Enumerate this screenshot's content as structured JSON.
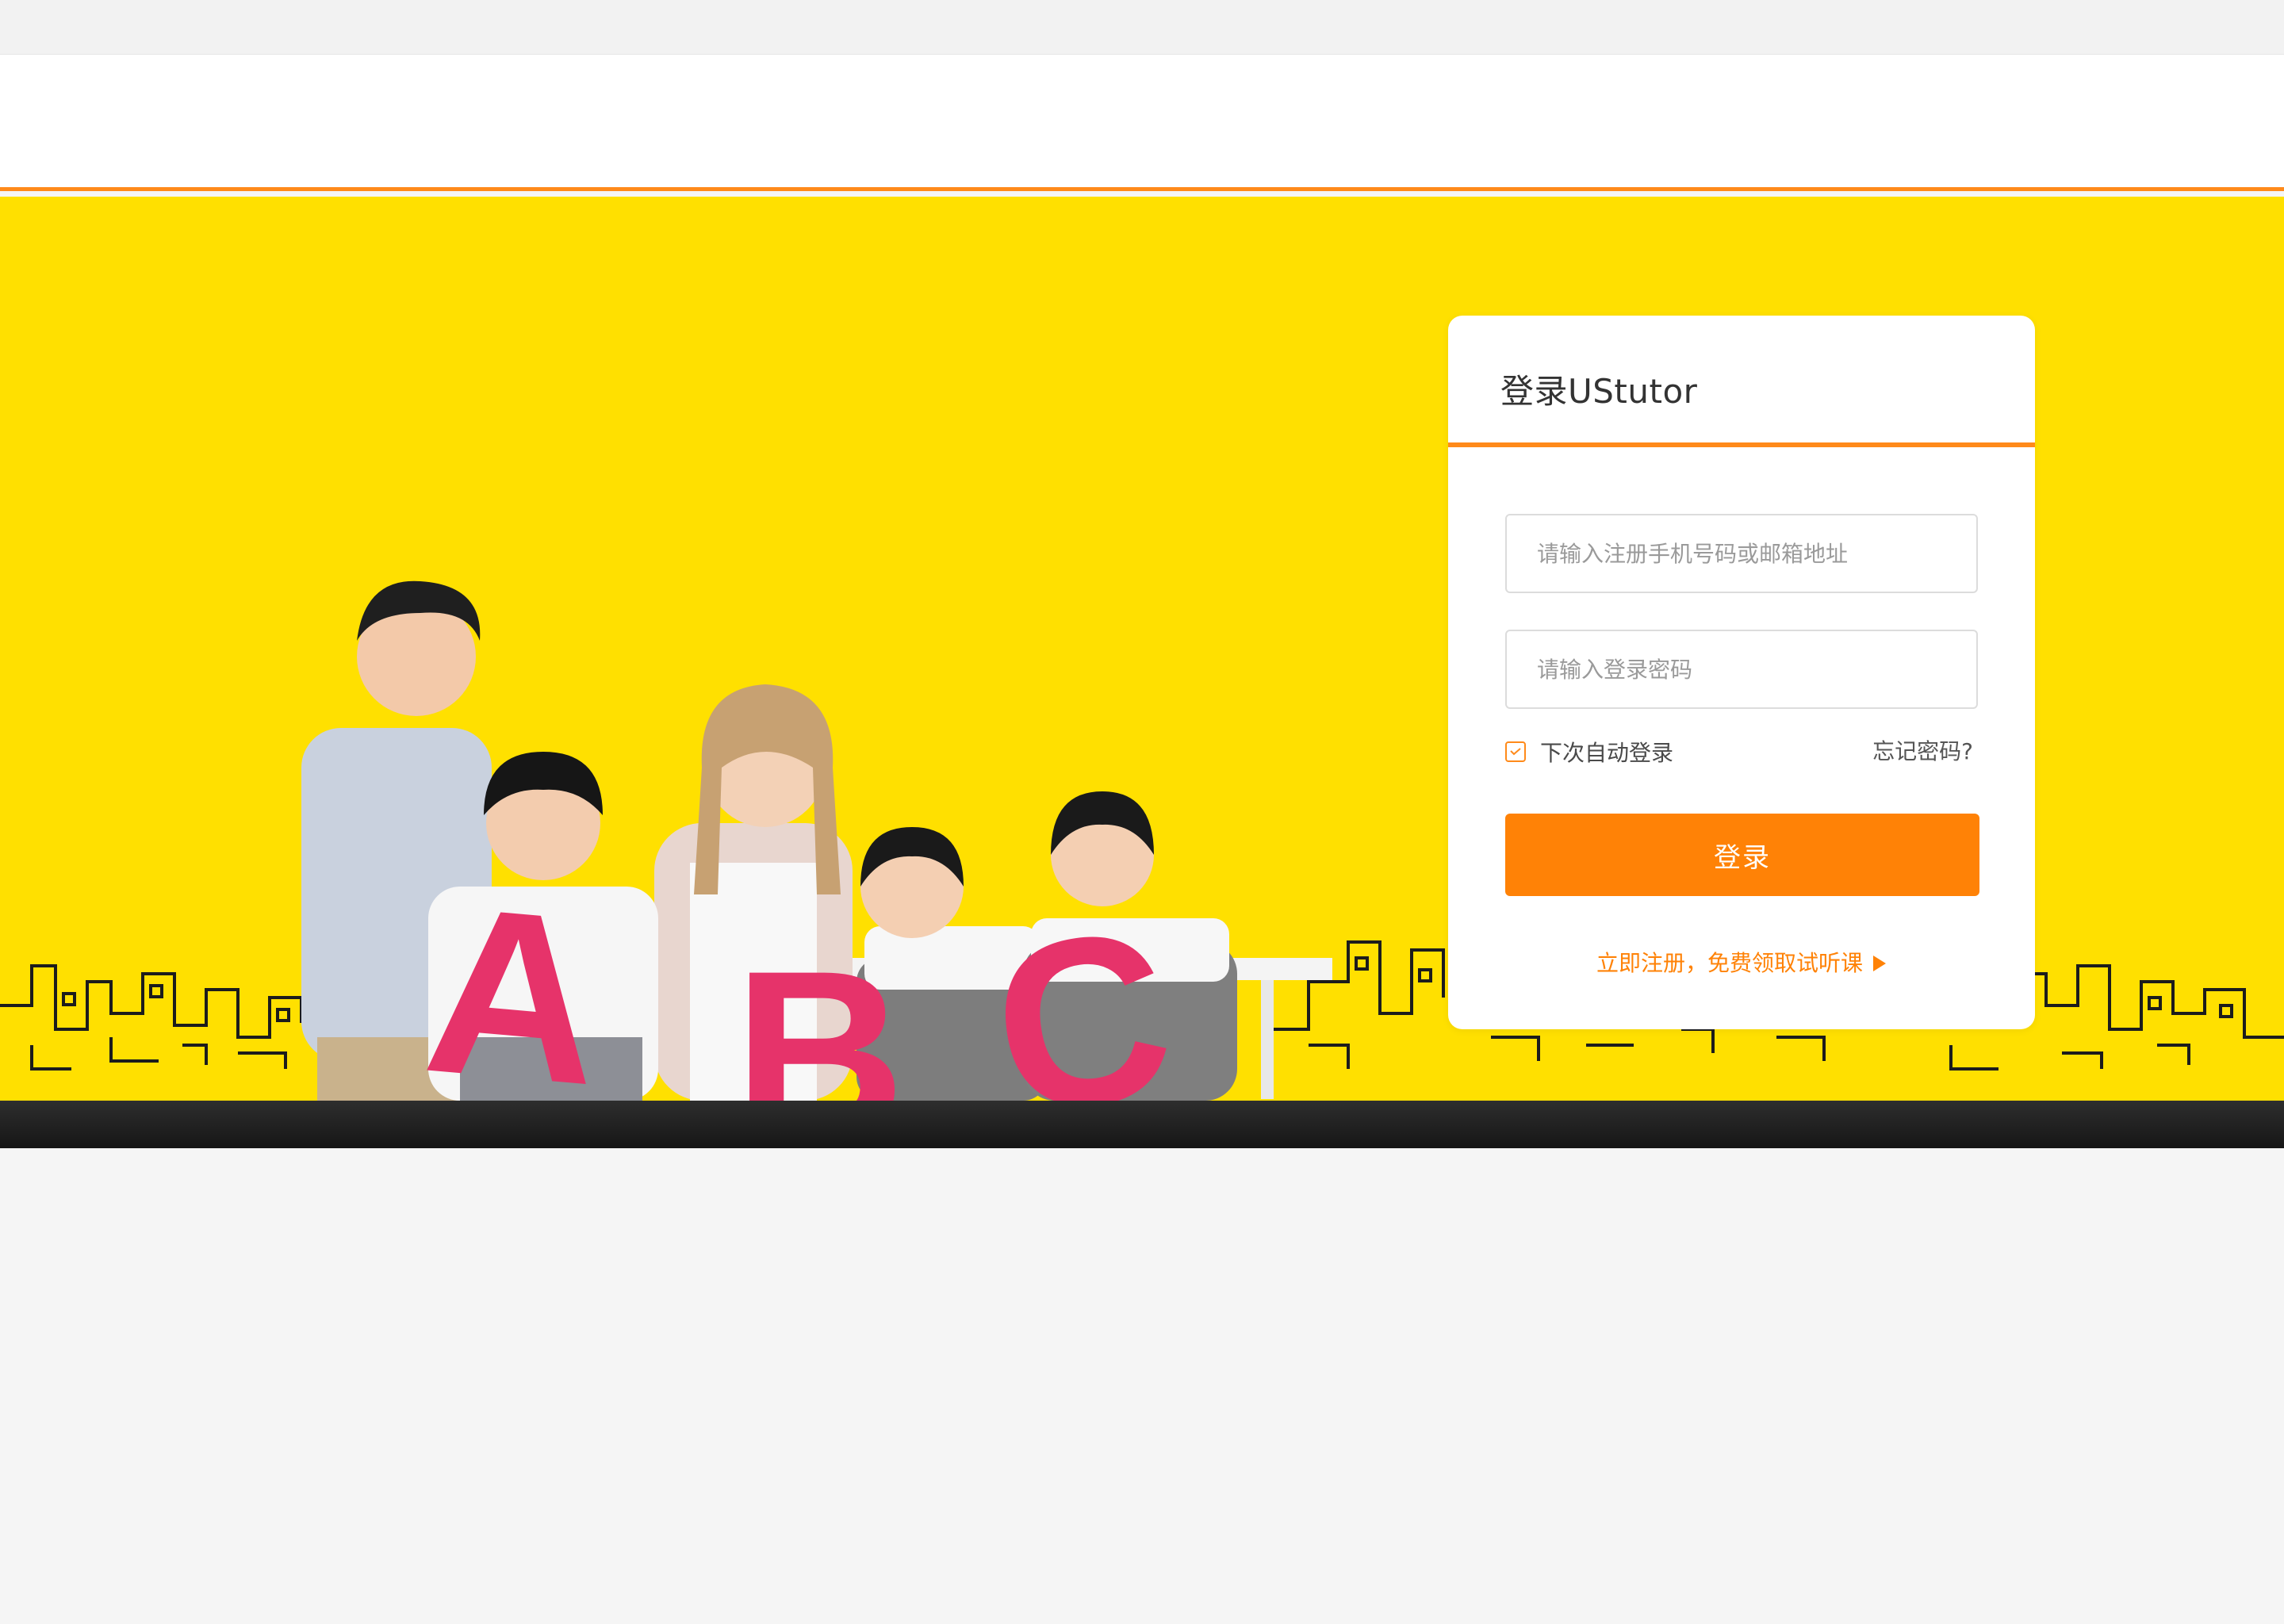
{
  "login": {
    "title": "登录UStutor",
    "username_placeholder": "请输入注册手机号码或邮箱地址",
    "password_placeholder": "请输入登录密码",
    "remember_label": "下次自动登录",
    "remember_checked": true,
    "forgot_label": "忘记密码?",
    "submit_label": "登录",
    "register_label": "立即注册，免费领取试听课"
  },
  "hero": {
    "letters": [
      "A",
      "B",
      "C"
    ]
  },
  "colors": {
    "accent": "#ff8206",
    "hero_background": "#ffe000",
    "letter_pink": "#e6336a"
  }
}
